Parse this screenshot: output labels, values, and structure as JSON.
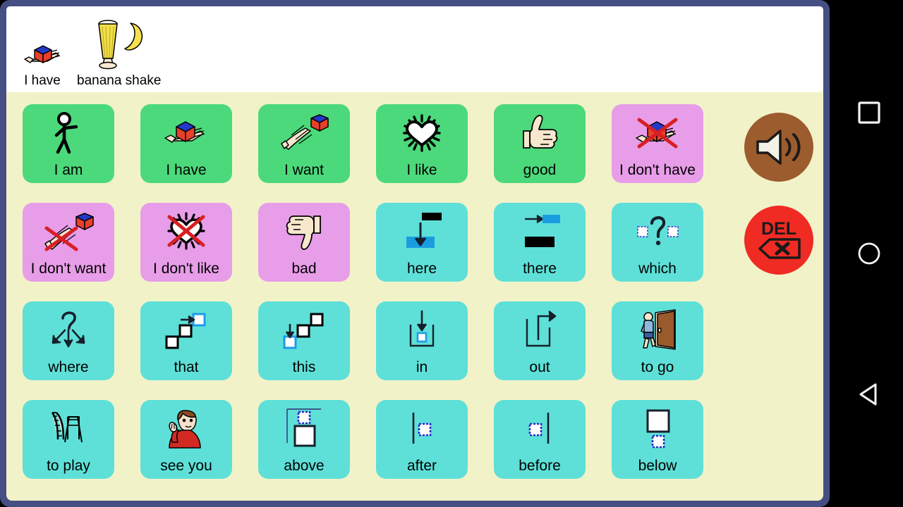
{
  "app": {
    "frame_color": "#464f83",
    "background_color": "#f2f2c9",
    "sentence_bar_color": "#ffffff"
  },
  "sentence_bar": {
    "name": "sentence-bar",
    "items": [
      {
        "label": "I have",
        "icon": "hand-holding-cube-icon"
      },
      {
        "label": "banana shake",
        "icon": "banana-shake-glass-icon"
      }
    ]
  },
  "grid": {
    "columns": 6,
    "rows": 4,
    "colors": {
      "green": "#4cd97b",
      "pink": "#e79de8",
      "cyan": "#5ee0d8"
    },
    "buttons": [
      {
        "label": "I am",
        "color": "#4cd97b",
        "icon": "stick-figure-person-icon"
      },
      {
        "label": "I have",
        "color": "#4cd97b",
        "icon": "hand-holding-cube-icon"
      },
      {
        "label": "I want",
        "color": "#4cd97b",
        "icon": "hand-reaching-cube-icon"
      },
      {
        "label": "I like",
        "color": "#4cd97b",
        "icon": "shining-heart-icon"
      },
      {
        "label": "good",
        "color": "#4cd97b",
        "icon": "thumbs-up-icon"
      },
      {
        "label": "I don't have",
        "color": "#e79de8",
        "icon": "hand-holding-cube-crossed-icon"
      },
      {
        "label": "I don't want",
        "color": "#e79de8",
        "icon": "hand-reaching-cube-crossed-icon"
      },
      {
        "label": "I don't like",
        "color": "#e79de8",
        "icon": "shining-heart-crossed-icon"
      },
      {
        "label": "bad",
        "color": "#e79de8",
        "icon": "thumbs-down-icon"
      },
      {
        "label": "here",
        "color": "#5ee0d8",
        "icon": "arrow-down-to-bar-icon"
      },
      {
        "label": "there",
        "color": "#5ee0d8",
        "icon": "arrow-right-to-bar-icon"
      },
      {
        "label": "which",
        "color": "#5ee0d8",
        "icon": "question-mark-two-squares-icon"
      },
      {
        "label": "where",
        "color": "#5ee0d8",
        "icon": "question-mark-three-arrows-icon"
      },
      {
        "label": "that",
        "color": "#5ee0d8",
        "icon": "arrow-to-far-square-icon"
      },
      {
        "label": "this",
        "color": "#5ee0d8",
        "icon": "arrow-to-near-square-icon"
      },
      {
        "label": "in",
        "color": "#5ee0d8",
        "icon": "arrow-into-container-icon"
      },
      {
        "label": "out",
        "color": "#5ee0d8",
        "icon": "arrow-out-of-container-icon"
      },
      {
        "label": "to go",
        "color": "#5ee0d8",
        "icon": "person-walking-through-door-icon"
      },
      {
        "label": "to play",
        "color": "#5ee0d8",
        "icon": "playground-slide-icon"
      },
      {
        "label": "see you",
        "color": "#5ee0d8",
        "icon": "person-waving-icon"
      },
      {
        "label": "above",
        "color": "#5ee0d8",
        "icon": "square-above-box-icon"
      },
      {
        "label": "after",
        "color": "#5ee0d8",
        "icon": "square-right-of-line-icon"
      },
      {
        "label": "before",
        "color": "#5ee0d8",
        "icon": "square-left-of-line-icon"
      },
      {
        "label": "below",
        "color": "#5ee0d8",
        "icon": "square-below-box-icon"
      }
    ]
  },
  "actions": {
    "speak": {
      "name": "speak-button",
      "icon": "speaker-volume-icon",
      "color": "#9c5c2e"
    },
    "delete": {
      "name": "delete-button",
      "icon": "del-backspace-icon",
      "color": "#ef2b24",
      "label": "DEL"
    }
  },
  "navbar": {
    "background": "#000000",
    "buttons": [
      {
        "name": "recent-apps-button",
        "icon": "square-outline-icon"
      },
      {
        "name": "home-button",
        "icon": "circle-outline-icon"
      },
      {
        "name": "back-button",
        "icon": "triangle-left-icon"
      }
    ]
  }
}
